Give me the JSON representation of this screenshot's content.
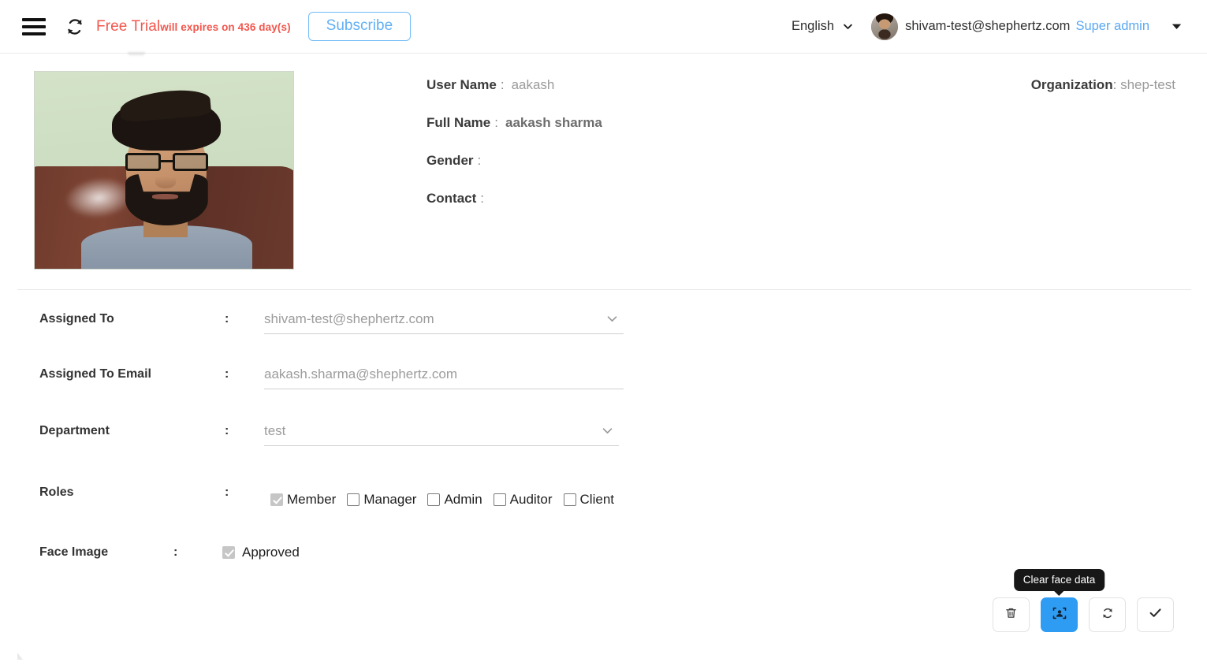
{
  "header": {
    "menu_icon": "hamburger-icon",
    "sync_icon": "sync-refresh-icon",
    "trial_title": "Free Trial",
    "trial_note": "will expires on 436 day(s)",
    "subscribe_label": "Subscribe",
    "language": "English",
    "language_chevron_icon": "chevron-down-icon",
    "user_email": "shivam-test@shephertz.com",
    "user_role": "Super admin",
    "account_caret_icon": "caret-down-icon",
    "avatar_icon": "user-avatar"
  },
  "profile": {
    "photo_alt": "face-photo",
    "fields": [
      {
        "label": "User Name",
        "sep": ":",
        "value": "aakash",
        "emphasis": false
      },
      {
        "label": "Full Name",
        "sep": ":",
        "value": "aakash sharma",
        "emphasis": true
      },
      {
        "label": "Gender",
        "sep": ":",
        "value": "",
        "emphasis": false
      },
      {
        "label": "Contact",
        "sep": ":",
        "value": "",
        "emphasis": false
      }
    ],
    "organization_label": "Organization",
    "organization_sep": ":",
    "organization_value": "shep-test"
  },
  "form": {
    "assigned_to": {
      "label": "Assigned To",
      "colon": ":",
      "value": "shivam-test@shephertz.com",
      "chevron_icon": "chevron-down-icon"
    },
    "assigned_to_email": {
      "label": "Assigned To Email",
      "colon": ":",
      "value": "aakash.sharma@shephertz.com",
      "placeholder": "aakash.sharma@shephertz.com"
    },
    "department": {
      "label": "Department",
      "colon": ":",
      "value": "test",
      "chevron_icon": "chevron-down-icon"
    },
    "roles": {
      "label": "Roles",
      "colon": ":",
      "items": [
        {
          "label": "Member",
          "checked": true,
          "disabled": true
        },
        {
          "label": "Manager",
          "checked": false,
          "disabled": false
        },
        {
          "label": "Admin",
          "checked": false,
          "disabled": false
        },
        {
          "label": "Auditor",
          "checked": false,
          "disabled": false
        },
        {
          "label": "Client",
          "checked": false,
          "disabled": false
        }
      ]
    },
    "face_image": {
      "label": "Face Image",
      "colon": ":",
      "approved_label": "Approved",
      "checked": true,
      "disabled": true
    }
  },
  "actions": {
    "tooltip": "Clear face data",
    "buttons": [
      {
        "name": "delete-button",
        "icon": "trash-icon",
        "active": false
      },
      {
        "name": "clear-face-data-button",
        "icon": "face-clear-icon",
        "active": true
      },
      {
        "name": "refresh-button",
        "icon": "refresh-icon",
        "active": false
      },
      {
        "name": "confirm-button",
        "icon": "check-icon",
        "active": false
      }
    ]
  },
  "colors": {
    "accent_blue": "#2f9cf4",
    "link_blue": "#5aa9f2",
    "trial_red": "#f2564d",
    "subscribe_border": "#72bcf7",
    "tooltip_bg": "#171717",
    "disabled_check": "#c6c6c6"
  }
}
